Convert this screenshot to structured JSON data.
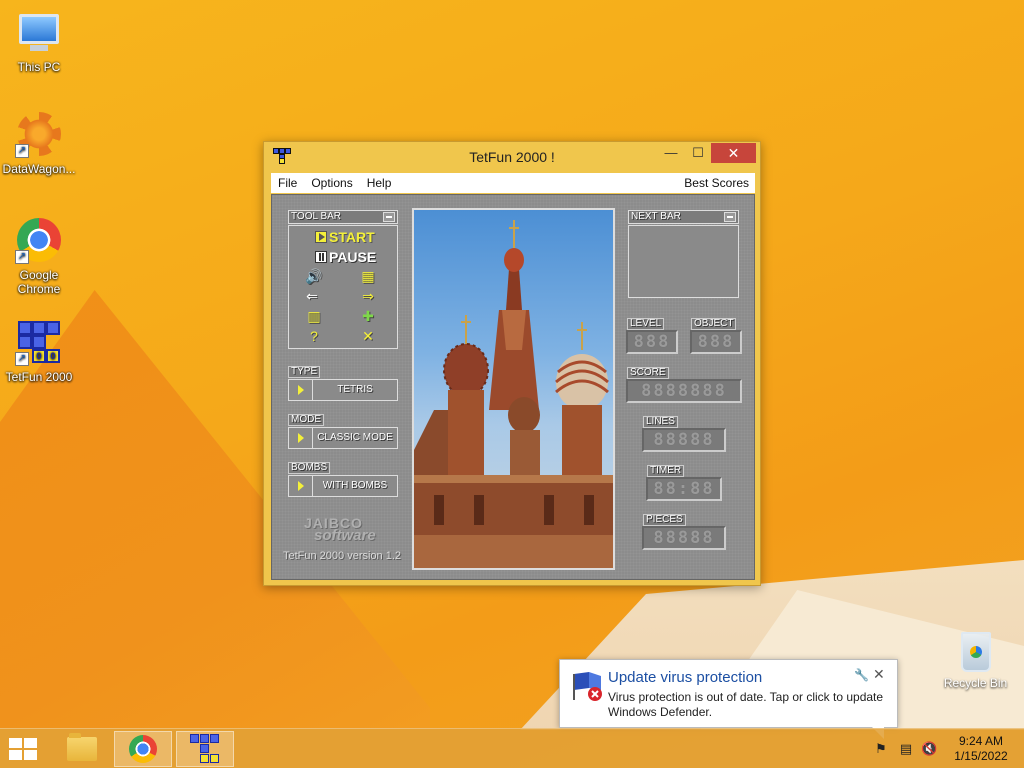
{
  "desktop": {
    "icons": [
      {
        "label": "This PC"
      },
      {
        "label": "DataWagon..."
      },
      {
        "label": "Google Chrome"
      },
      {
        "label": "TetFun 2000"
      }
    ],
    "recycle_bin": "Recycle Bin"
  },
  "window": {
    "title": "TetFun 2000 !",
    "min": "—",
    "max": "☐",
    "close": "✕",
    "menu": {
      "file": "File",
      "options": "Options",
      "help": "Help",
      "best_scores": "Best Scores"
    }
  },
  "game": {
    "toolbar_title": "TOOL BAR",
    "start": "START",
    "pause": "PAUSE",
    "type_label": "TYPE",
    "type_value": "TETRIS",
    "mode_label": "MODE",
    "mode_value": "CLASSIC MODE",
    "bombs_label": "BOMBS",
    "bombs_value": "WITH BOMBS",
    "logo_line1": "JAIBCO",
    "logo_line2": "software",
    "version": "TetFun 2000 version 1.2",
    "nextbar_title": "NEXT BAR",
    "level_label": "LEVEL",
    "level_value": "888",
    "object_label": "OBJECT",
    "object_value": "888",
    "score_label": "SCORE",
    "score_value": "8888888",
    "lines_label": "LINES",
    "lines_value": "88888",
    "timer_label": "TIMER",
    "timer_value": "88:88",
    "pieces_label": "PIECES",
    "pieces_value": "88888"
  },
  "notification": {
    "title": "Update virus protection",
    "body": "Virus protection is out of date. Tap or click to update Windows Defender."
  },
  "taskbar": {
    "time": "9:24 AM",
    "date": "1/15/2022"
  },
  "colors": {
    "desktop": "#f5a81a",
    "accent_yellow": "#f4f03a",
    "close_red": "#c7453b",
    "toast_title": "#1c4fa3"
  }
}
